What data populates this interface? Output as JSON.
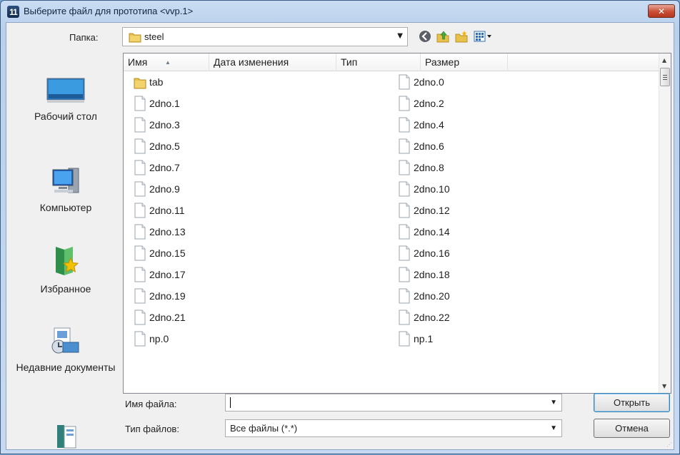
{
  "window": {
    "title": "Выберите файл для прототипа <vvp.1>",
    "app_icon_text": "11",
    "close_glyph": "✕"
  },
  "folder": {
    "label": "Папка:",
    "current": "steel"
  },
  "places": [
    {
      "label": "Рабочий стол",
      "icon": "desktop-icon"
    },
    {
      "label": "Компьютер",
      "icon": "computer-icon"
    },
    {
      "label": "Избранное",
      "icon": "favorites-icon"
    },
    {
      "label": "Недавние документы",
      "icon": "recent-documents-icon"
    },
    {
      "label": "",
      "icon": "libraries-icon"
    }
  ],
  "columns": [
    "Имя",
    "Дата изменения",
    "Тип",
    "Размер"
  ],
  "files_left": [
    {
      "name": "tab",
      "kind": "folder"
    },
    {
      "name": "2dno.1",
      "kind": "file"
    },
    {
      "name": "2dno.3",
      "kind": "file"
    },
    {
      "name": "2dno.5",
      "kind": "file"
    },
    {
      "name": "2dno.7",
      "kind": "file"
    },
    {
      "name": "2dno.9",
      "kind": "file"
    },
    {
      "name": "2dno.11",
      "kind": "file"
    },
    {
      "name": "2dno.13",
      "kind": "file"
    },
    {
      "name": "2dno.15",
      "kind": "file"
    },
    {
      "name": "2dno.17",
      "kind": "file"
    },
    {
      "name": "2dno.19",
      "kind": "file"
    },
    {
      "name": "2dno.21",
      "kind": "file"
    },
    {
      "name": "np.0",
      "kind": "file"
    }
  ],
  "files_right": [
    {
      "name": "2dno.0",
      "kind": "file"
    },
    {
      "name": "2dno.2",
      "kind": "file"
    },
    {
      "name": "2dno.4",
      "kind": "file"
    },
    {
      "name": "2dno.6",
      "kind": "file"
    },
    {
      "name": "2dno.8",
      "kind": "file"
    },
    {
      "name": "2dno.10",
      "kind": "file"
    },
    {
      "name": "2dno.12",
      "kind": "file"
    },
    {
      "name": "2dno.14",
      "kind": "file"
    },
    {
      "name": "2dno.16",
      "kind": "file"
    },
    {
      "name": "2dno.18",
      "kind": "file"
    },
    {
      "name": "2dno.20",
      "kind": "file"
    },
    {
      "name": "2dno.22",
      "kind": "file"
    },
    {
      "name": "np.1",
      "kind": "file"
    }
  ],
  "filename": {
    "label": "Имя файла:",
    "value": ""
  },
  "filetype": {
    "label": "Тип файлов:",
    "value": "Все файлы (*.*)"
  },
  "buttons": {
    "open": "Открыть",
    "cancel": "Отмена"
  },
  "colors": {
    "title_bar": "#c9dcf2",
    "close_button": "#c84e35",
    "folder_yellow": "#e8c14a"
  }
}
